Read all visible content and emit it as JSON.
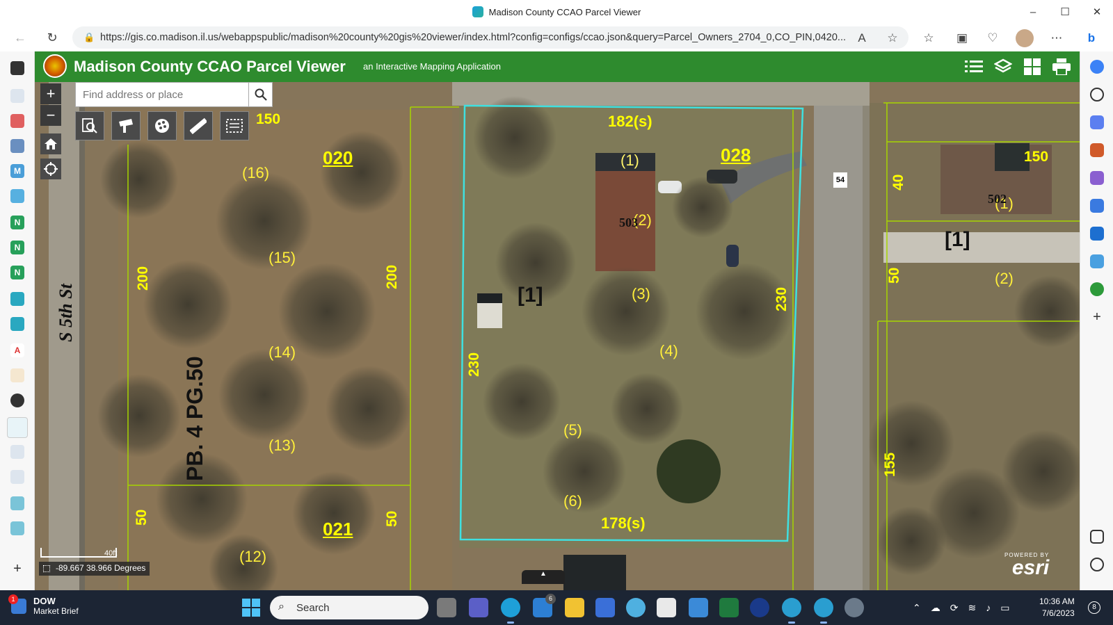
{
  "browser": {
    "tab_title": "Madison County CCAO Parcel Viewer",
    "url": "https://gis.co.madison.il.us/webappspublic/madison%20county%20gis%20viewer/index.html?config=configs/ccao.json&query=Parcel_Owners_2704_0,CO_PIN,0420...",
    "minimize": "–",
    "maximize": "☐",
    "close": "✕"
  },
  "app": {
    "title": "Madison County CCAO Parcel Viewer",
    "subtitle": "an Interactive Mapping Application",
    "brand_color": "#2e8b2e"
  },
  "search": {
    "placeholder": "Find address or place"
  },
  "map": {
    "street_name": "S 5th St",
    "plat_label": "PB. 4 PG.50",
    "route_shield": "54",
    "scale_label": "40ft",
    "coordinates": "-89.667 38.966 Degrees",
    "highlight_color": "#3fe0e0",
    "parcels": {
      "p020": "020",
      "p021": "021",
      "p028": "028"
    },
    "dimensions": {
      "d150_left": "150",
      "d200_a": "200",
      "d200_b": "200",
      "d50_a": "50",
      "d50_b": "50",
      "d182": "182(s)",
      "d178": "178(s)",
      "d230_left": "230",
      "d230_right": "230",
      "d150_right": "150",
      "d40": "40",
      "d50_right": "50",
      "d155": "155"
    },
    "lots": {
      "l16": "(16)",
      "l15": "(15)",
      "l14": "(14)",
      "l13": "(13)",
      "l12": "(12)",
      "l1": "(1)",
      "l2": "(2)",
      "l3": "(3)",
      "l4": "(4)",
      "l5": "(5)",
      "l6": "(6)",
      "r1": "(1)",
      "r2": "(2)"
    },
    "block_a": "[1]",
    "block_b": "[1]",
    "address_503": "503",
    "address_502": "502"
  },
  "esri": {
    "powered": "POWERED BY",
    "name": "esri"
  },
  "taskbar": {
    "weather_title": "DOW",
    "weather_sub": "Market Brief",
    "weather_badge": "1",
    "search_label": "Search",
    "mail_badge": "6",
    "time": "10:36 AM",
    "date": "7/6/2023",
    "notifications": "8"
  }
}
